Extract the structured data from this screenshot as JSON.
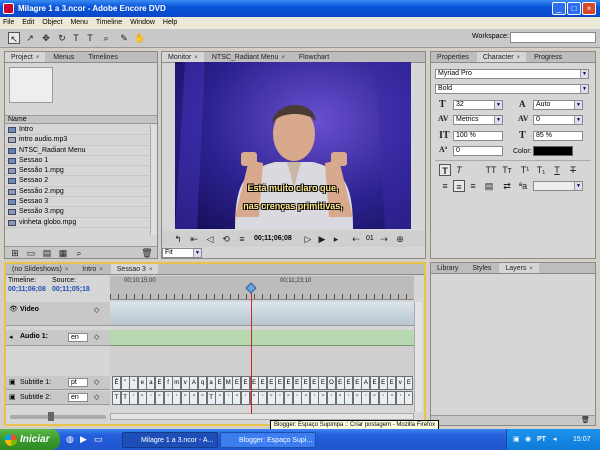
{
  "window": {
    "title": "Milagre 1 a 3.ncor - Adobe Encore DVD"
  },
  "menu": [
    "File",
    "Edit",
    "Object",
    "Menu",
    "Timeline",
    "Window",
    "Help"
  ],
  "toolbar": {
    "workspace_label": "Workspace:"
  },
  "project_panel": {
    "tabs": [
      "Project",
      "Menus",
      "Timelines"
    ],
    "column_name": "Name",
    "items": [
      "Intro",
      "intro audio.mp3",
      "NTSC_Radiant Menu",
      "Sessao 1",
      "Sessão 1.mpg",
      "Sessao 2",
      "Sessão 2.mpg",
      "Sessao 3",
      "Sessão 3.mpg",
      "vinheta globo.mpg"
    ]
  },
  "monitor_panel": {
    "tabs": [
      "Monitor",
      "NTSC_Radiant Menu",
      "Flowchart"
    ],
    "subtitle_line1": "Está muito claro que,",
    "subtitle_line2": "nas crenças primitivas,",
    "timecode": "00;11;06;08",
    "chapter": "01",
    "fit": "Fit"
  },
  "character_panel": {
    "tabs": [
      "Properties",
      "Character",
      "Progress"
    ],
    "font": "Myriad Pro",
    "style": "Bold",
    "size": "32",
    "leading": "Auto",
    "kerning": "Metrics",
    "tracking": "0",
    "h_scale": "100 %",
    "v_scale": "85 %",
    "baseline": "0",
    "color_label": "Color:",
    "color": "#000000"
  },
  "layers_panel": {
    "tabs": [
      "Library",
      "Styles",
      "Layers"
    ]
  },
  "timeline_panel": {
    "tabs": [
      "(no Slideshows)",
      "Intro",
      "Sessao 3"
    ],
    "timeline_label": "Timeline:",
    "source_label": "Source:",
    "timeline_tc": "00;11;06;08",
    "source_tc": "00;11;05;18",
    "ruler_start": "00;10;15;00",
    "ruler_end": "00;11;23;10",
    "playhead_progress": 0.5,
    "tracks": {
      "video": "Video",
      "audio": "Audio 1:",
      "audio_lang": "en",
      "subtitle1": "Subtitle 1:",
      "subtitle1_lang": "pt",
      "subtitle2": "Subtitle 2:",
      "subtitle2_lang": "en"
    },
    "sub1_clips": [
      "Ê",
      "\"",
      "\"",
      "e",
      "a",
      "E",
      "f",
      "m",
      "v",
      "A",
      "q",
      "a",
      "E",
      "M",
      "E",
      "E",
      "E",
      "E",
      "E",
      "E",
      "E",
      "E",
      "E",
      "E",
      "E",
      "O",
      "E",
      "E",
      "E",
      "A",
      "E",
      "E",
      "E",
      "v",
      "E"
    ],
    "sub2_clips": [
      "T",
      "T",
      "'",
      "\"",
      "'",
      "\"",
      "'",
      "'",
      "\"",
      "\"",
      "\"",
      "T",
      "\"",
      "'",
      "\"",
      "'",
      "\"",
      "'",
      "\"",
      "'",
      "\"",
      "'",
      "\"",
      "'",
      "\"",
      "'",
      "\"",
      "'",
      "\"",
      "'",
      "\"",
      "'",
      "\"",
      "'",
      "\""
    ]
  },
  "tooltip": "Blogger: Espaço Supimpa :: Criar postagem - Mozilla Firefox",
  "taskbar": {
    "start": "Iniciar",
    "tasks": [
      "Milagre 1 a 3.ncor - A...",
      "Blogger: Espaço Supi..."
    ],
    "clock": "15:07",
    "lang": "PT"
  }
}
